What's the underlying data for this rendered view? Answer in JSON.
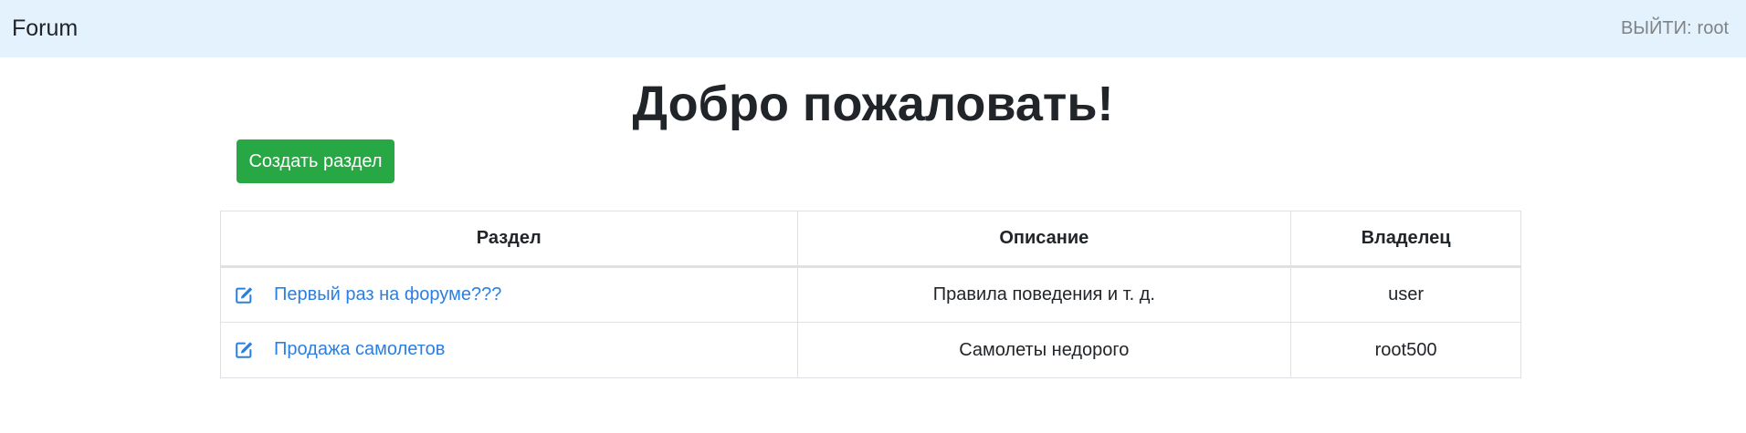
{
  "navbar": {
    "brand": "Forum",
    "logout_label": "ВЫЙТИ:",
    "username": "root"
  },
  "main": {
    "title": "Добро пожаловать!",
    "create_button_label": "Создать раздел"
  },
  "table": {
    "headers": [
      "Раздел",
      "Описание",
      "Владелец"
    ],
    "rows": [
      {
        "section": "Первый раз на форуме???",
        "description": "Правила поведения и т. д.",
        "owner": "user"
      },
      {
        "section": "Продажа самолетов",
        "description": "Самолеты недорого",
        "owner": "root500"
      }
    ]
  },
  "colors": {
    "navbar_bg": "#e3f2fd",
    "create_button": "#28a745",
    "link": "#2a7fe2"
  },
  "icons": {
    "edit": "edit-icon"
  }
}
